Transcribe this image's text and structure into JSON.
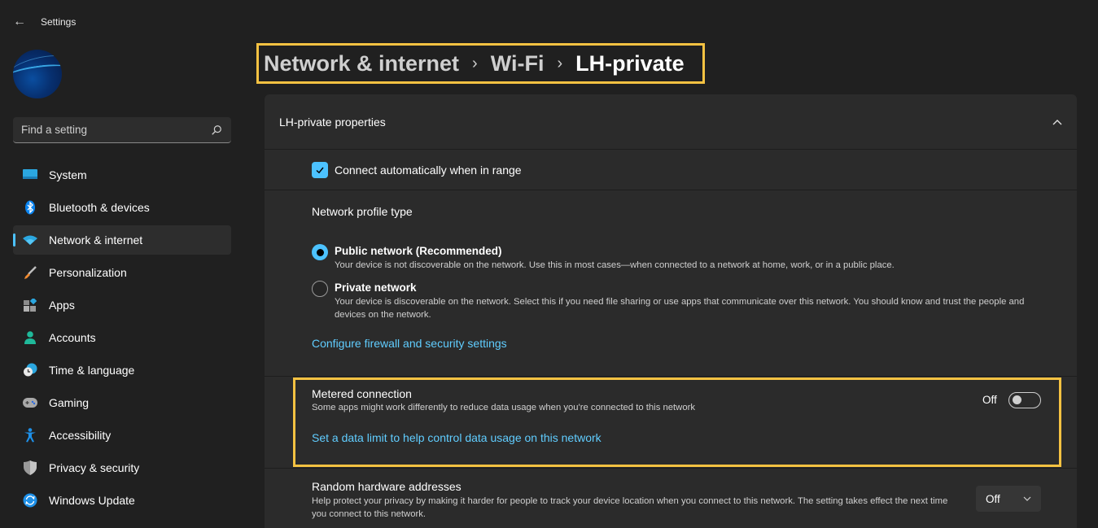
{
  "window": {
    "title": "Settings",
    "back_icon": "arrow-left-icon"
  },
  "sidebar": {
    "search": {
      "placeholder": "Find a setting",
      "value": ""
    },
    "items": [
      {
        "label": "System",
        "icon": "monitor-icon",
        "active": false
      },
      {
        "label": "Bluetooth & devices",
        "icon": "bluetooth-icon",
        "active": false
      },
      {
        "label": "Network & internet",
        "icon": "wifi-icon",
        "active": true
      },
      {
        "label": "Personalization",
        "icon": "paintbrush-icon",
        "active": false
      },
      {
        "label": "Apps",
        "icon": "apps-icon",
        "active": false
      },
      {
        "label": "Accounts",
        "icon": "person-icon",
        "active": false
      },
      {
        "label": "Time & language",
        "icon": "clock-globe-icon",
        "active": false
      },
      {
        "label": "Gaming",
        "icon": "gamepad-icon",
        "active": false
      },
      {
        "label": "Accessibility",
        "icon": "accessibility-icon",
        "active": false
      },
      {
        "label": "Privacy & security",
        "icon": "shield-icon",
        "active": false
      },
      {
        "label": "Windows Update",
        "icon": "update-icon",
        "active": false
      }
    ]
  },
  "breadcrumb": {
    "items": [
      "Network & internet",
      "Wi-Fi",
      "LH-private"
    ],
    "separator": "›"
  },
  "properties": {
    "title": "LH-private properties",
    "connect_automatically": {
      "label": "Connect automatically when in range",
      "checked": true
    },
    "profile": {
      "title": "Network profile type",
      "options": [
        {
          "label": "Public network (Recommended)",
          "description": "Your device is not discoverable on the network. Use this in most cases—when connected to a network at home, work, or in a public place.",
          "selected": true
        },
        {
          "label": "Private network",
          "description": "Your device is discoverable on the network. Select this if you need file sharing or use apps that communicate over this network. You should know and trust the people and devices on the network.",
          "selected": false
        }
      ],
      "firewall_link": "Configure firewall and security settings"
    },
    "metered": {
      "title": "Metered connection",
      "description": "Some apps might work differently to reduce data usage when you're connected to this network",
      "toggle_label": "Off",
      "toggle_on": false,
      "data_limit_link": "Set a data limit to help control data usage on this network"
    },
    "random_hw": {
      "title": "Random hardware addresses",
      "description": "Help protect your privacy by making it harder for people to track your device location when you connect to this network. The setting takes effect the next time you connect to this network.",
      "value": "Off"
    }
  },
  "colors": {
    "accent": "#4cc2ff",
    "link": "#60cdff",
    "highlight": "#f5c242"
  }
}
